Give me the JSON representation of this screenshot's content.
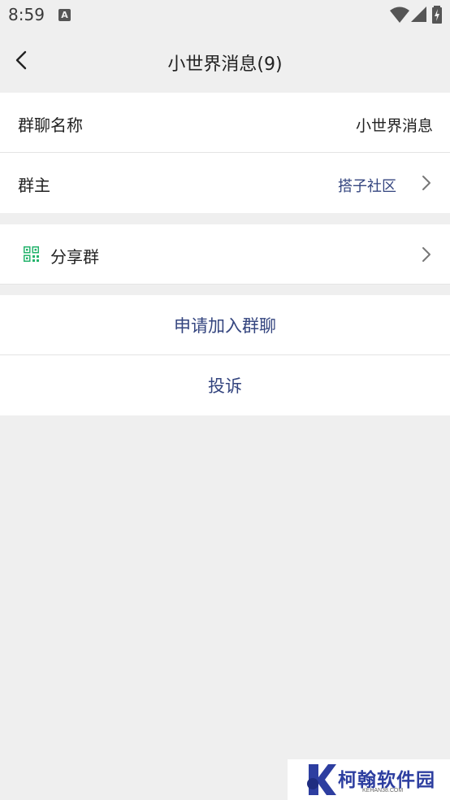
{
  "status_bar": {
    "time": "8:59",
    "notification_icon_letter": "A"
  },
  "header": {
    "title": "小世界消息(9)"
  },
  "group_info": {
    "name_label": "群聊名称",
    "name_value": "小世界消息",
    "owner_label": "群主",
    "owner_value": "搭子社区"
  },
  "share": {
    "label": "分享群",
    "icon_color": "#25b36c"
  },
  "actions": {
    "join_label": "申请加入群聊",
    "report_label": "投诉"
  },
  "colors": {
    "background": "#efefef",
    "accent": "#34457f",
    "text": "#222222"
  },
  "watermark": {
    "title": "柯翰软件园",
    "subtitle": "KEHAN38.COM"
  }
}
